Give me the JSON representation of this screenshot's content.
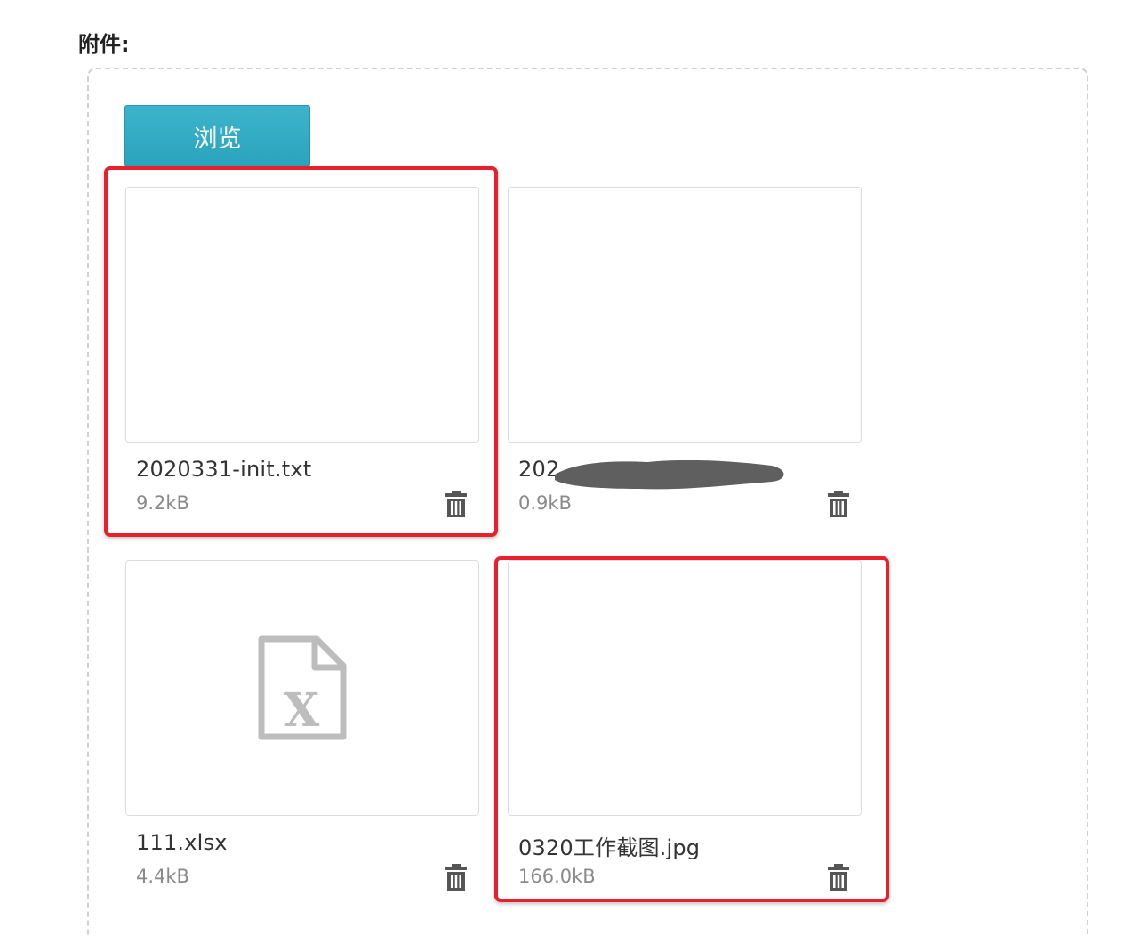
{
  "attachments": {
    "label": "附件:",
    "browse_label": "浏览",
    "files": [
      {
        "name": "2020331-init.txt",
        "size": "9.2kB",
        "thumb_icon": "blank-preview",
        "highlighted": true
      },
      {
        "name": "202",
        "size": "0.9kB",
        "thumb_icon": "blank-preview",
        "redacted": true
      },
      {
        "name": "111.xlsx",
        "size": "4.4kB",
        "thumb_icon": "excel-file-icon"
      },
      {
        "name": "0320工作截图.jpg",
        "size": "166.0kB",
        "thumb_icon": "blank-preview",
        "highlighted": true
      }
    ]
  },
  "colors": {
    "browse_button": "#2aa3bc",
    "highlight_border": "#e8202e",
    "icon_gray": "#bdbdbd",
    "trash_icon": "#555555"
  }
}
